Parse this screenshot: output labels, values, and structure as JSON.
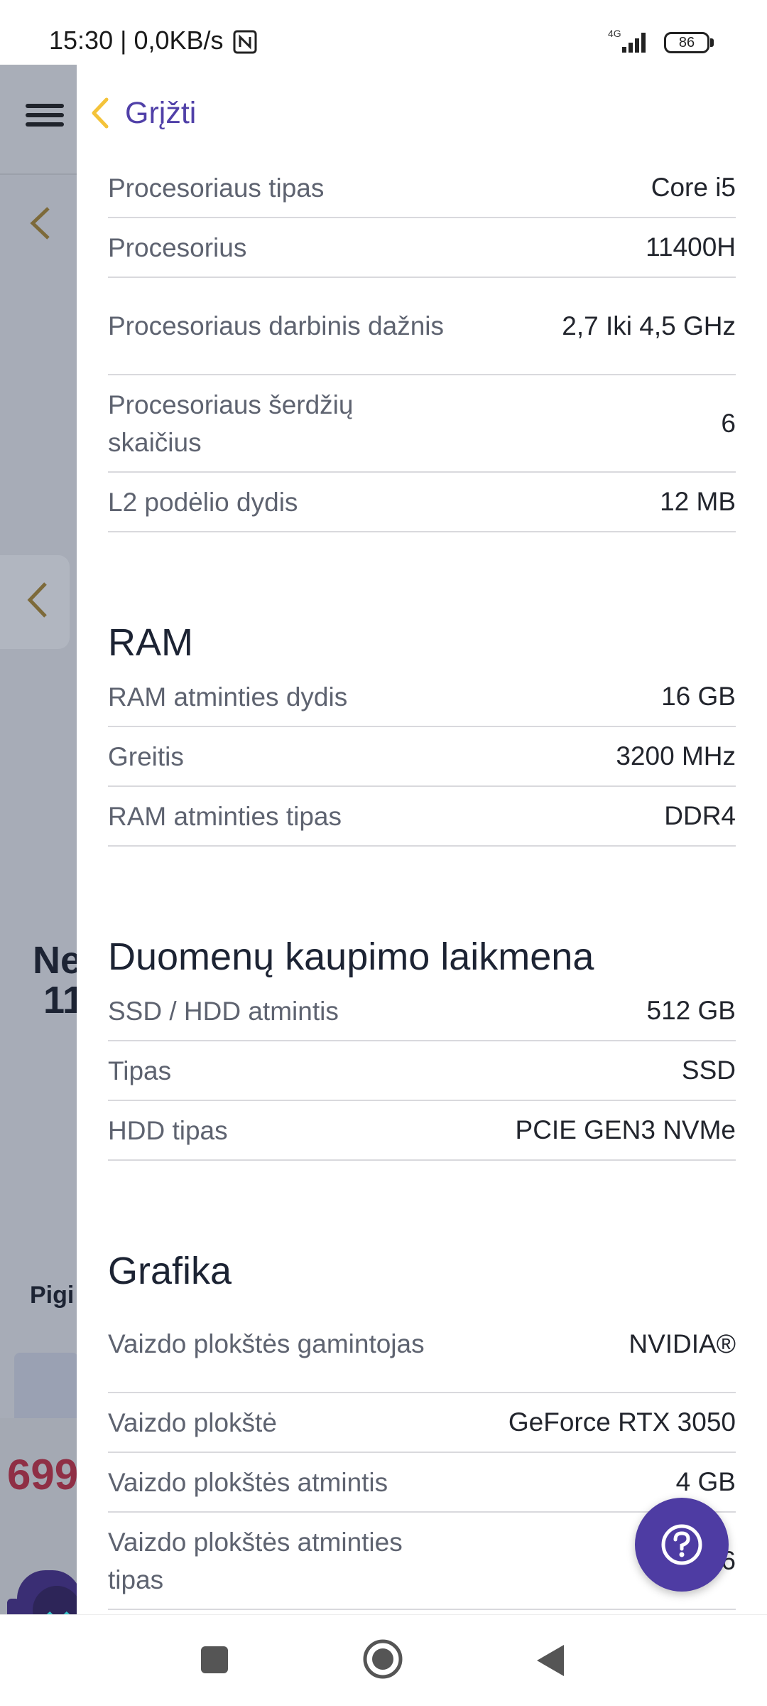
{
  "status_bar": {
    "time_speed": "15:30 | 0,0KB/s",
    "network": "4G",
    "battery": "86"
  },
  "background_page": {
    "title_partial": "Ne\n 11",
    "subtitle_partial": "Pigi",
    "price_partial": "699"
  },
  "drawer": {
    "back_label": "Grįžti",
    "sections": [
      {
        "title": "",
        "rows": [
          {
            "label": "Procesoriaus tipas",
            "value": "Core i5"
          },
          {
            "label": "Procesorius",
            "value": "11400H"
          },
          {
            "label": "Procesoriaus darbinis dažnis",
            "value": "2,7 Iki 4,5 GHz"
          },
          {
            "label": "Procesoriaus šerdžių skaičius",
            "value": "6"
          },
          {
            "label": "L2 podėlio dydis",
            "value": "12 MB"
          }
        ]
      },
      {
        "title": "RAM",
        "rows": [
          {
            "label": "RAM atminties dydis",
            "value": "16 GB"
          },
          {
            "label": "Greitis",
            "value": "3200 MHz"
          },
          {
            "label": "RAM atminties tipas",
            "value": "DDR4"
          }
        ]
      },
      {
        "title": "Duomenų kaupimo laikmena",
        "rows": [
          {
            "label": "SSD / HDD atmintis",
            "value": "512 GB"
          },
          {
            "label": "Tipas",
            "value": "SSD"
          },
          {
            "label": "HDD tipas",
            "value": "PCIE GEN3 NVMe"
          }
        ]
      },
      {
        "title": "Grafika",
        "rows": [
          {
            "label": "Vaizdo plokštės gamintojas",
            "value": "NVIDIA®"
          },
          {
            "label": "Vaizdo plokštė",
            "value": "GeForce RTX 3050"
          },
          {
            "label": "Vaizdo plokštės atmintis",
            "value": "4 GB"
          },
          {
            "label": "Vaizdo plokštės atminties tipas",
            "value": "6"
          }
        ]
      }
    ]
  },
  "colors": {
    "accent": "#4e3ca3",
    "back_chevron": "#f4c33a",
    "overlay": "#a7acb7"
  },
  "icons": {
    "help": "question-mark-icon",
    "back": "chevron-left-icon",
    "menu": "hamburger-icon"
  }
}
